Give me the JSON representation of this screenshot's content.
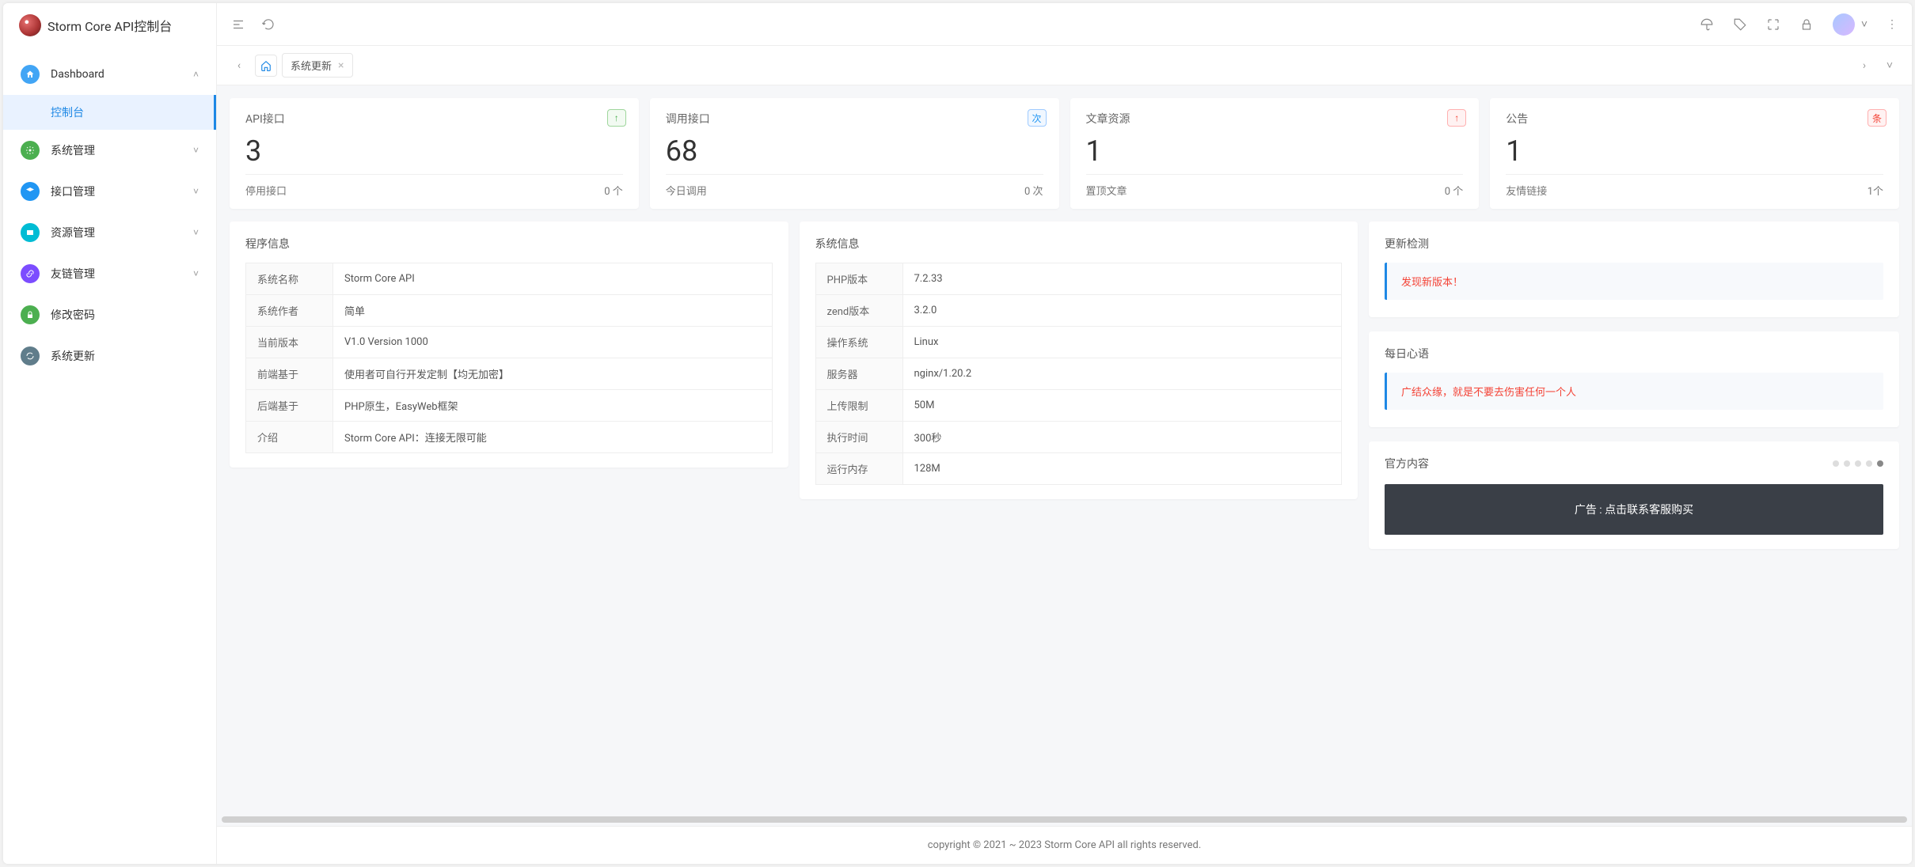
{
  "app_title": "Storm Core API控制台",
  "sidebar": {
    "items": [
      {
        "label": "Dashboard",
        "expandable": true,
        "expanded": true
      },
      {
        "label": "系统管理",
        "expandable": true,
        "expanded": false
      },
      {
        "label": "接口管理",
        "expandable": true,
        "expanded": false
      },
      {
        "label": "资源管理",
        "expandable": true,
        "expanded": false
      },
      {
        "label": "友链管理",
        "expandable": true,
        "expanded": false
      },
      {
        "label": "修改密码",
        "expandable": false
      },
      {
        "label": "系统更新",
        "expandable": false
      }
    ],
    "sub_active": "控制台"
  },
  "tabs": {
    "active": "系统更新"
  },
  "stats": [
    {
      "title": "API接口",
      "value": "3",
      "sub_label": "停用接口",
      "sub_value": "0 个",
      "badge": "↑",
      "badge_class": "badge-green"
    },
    {
      "title": "调用接口",
      "value": "68",
      "sub_label": "今日调用",
      "sub_value": "0 次",
      "badge": "次",
      "badge_class": "badge-blue"
    },
    {
      "title": "文章资源",
      "value": "1",
      "sub_label": "置顶文章",
      "sub_value": "0 个",
      "badge": "↑",
      "badge_class": "badge-red"
    },
    {
      "title": "公告",
      "value": "1",
      "sub_label": "友情链接",
      "sub_value": "1个",
      "badge": "条",
      "badge_class": "badge-red"
    }
  ],
  "program_info": {
    "title": "程序信息",
    "rows": [
      {
        "k": "系统名称",
        "v": "Storm Core API"
      },
      {
        "k": "系统作者",
        "v": "简单"
      },
      {
        "k": "当前版本",
        "v": "V1.0 Version 1000"
      },
      {
        "k": "前端基于",
        "v": "使用者可自行开发定制【均无加密】"
      },
      {
        "k": "后端基于",
        "v": "PHP原生，EasyWeb框架"
      },
      {
        "k": "介绍",
        "v": "Storm Core API：连接无限可能"
      }
    ]
  },
  "system_info": {
    "title": "系统信息",
    "rows": [
      {
        "k": "PHP版本",
        "v": "7.2.33"
      },
      {
        "k": "zend版本",
        "v": "3.2.0"
      },
      {
        "k": "操作系统",
        "v": "Linux"
      },
      {
        "k": "服务器",
        "v": "nginx/1.20.2"
      },
      {
        "k": "上传限制",
        "v": "50M"
      },
      {
        "k": "执行时间",
        "v": "300秒"
      },
      {
        "k": "运行内存",
        "v": "128M"
      }
    ]
  },
  "update_check": {
    "title": "更新检测",
    "message": "发现新版本！"
  },
  "daily_quote": {
    "title": "每日心语",
    "message": "广结众缘，就是不要去伤害任何一个人"
  },
  "official": {
    "title": "官方内容",
    "ad_text": "广告 : 点击联系客服购买"
  },
  "footer": "copyright © 2021 ~ 2023 Storm Core API all rights reserved."
}
